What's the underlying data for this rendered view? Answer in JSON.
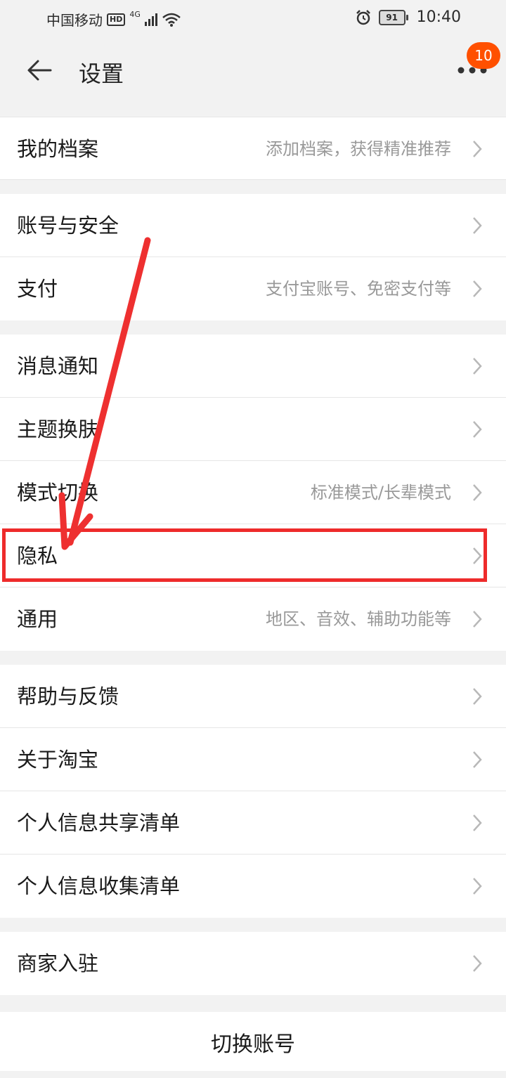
{
  "status_bar": {
    "carrier": "中国移动",
    "hd": "HD",
    "network": "4G",
    "battery": "91",
    "time": "10:40"
  },
  "header": {
    "title": "设置",
    "badge_count": "10"
  },
  "sections": [
    [
      {
        "label": "我的档案",
        "sub": "添加档案，获得精准推荐"
      }
    ],
    [
      {
        "label": "账号与安全",
        "sub": ""
      },
      {
        "label": "支付",
        "sub": "支付宝账号、免密支付等"
      }
    ],
    [
      {
        "label": "消息通知",
        "sub": ""
      },
      {
        "label": "主题换肤",
        "sub": ""
      },
      {
        "label": "模式切换",
        "sub": "标准模式/长辈模式"
      },
      {
        "label": "隐私",
        "sub": ""
      },
      {
        "label": "通用",
        "sub": "地区、音效、辅助功能等"
      }
    ],
    [
      {
        "label": "帮助与反馈",
        "sub": ""
      },
      {
        "label": "关于淘宝",
        "sub": ""
      },
      {
        "label": "个人信息共享清单",
        "sub": ""
      },
      {
        "label": "个人信息收集清单",
        "sub": ""
      }
    ],
    [
      {
        "label": "商家入驻",
        "sub": ""
      }
    ]
  ],
  "footer": {
    "switch_account": "切换账号"
  },
  "colors": {
    "accent": "#ff5000",
    "highlight": "#ee2b2b"
  }
}
